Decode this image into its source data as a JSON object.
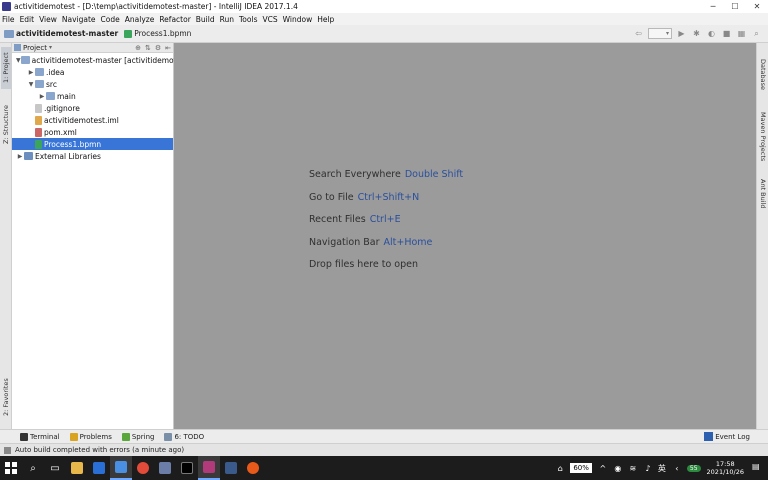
{
  "window": {
    "title": "activitidemotest - [D:\\temp\\activitidemotest-master] - IntelliJ IDEA 2017.1.4"
  },
  "menu": [
    "File",
    "Edit",
    "View",
    "Navigate",
    "Code",
    "Analyze",
    "Refactor",
    "Build",
    "Run",
    "Tools",
    "VCS",
    "Window",
    "Help"
  ],
  "navbar": {
    "project": "activitidemotest-master",
    "file": "Process1.bpmn"
  },
  "left_tabs": {
    "project": "1: Project",
    "structure": "Z: Structure",
    "favorites": "2: Favorites"
  },
  "right_tabs": {
    "database": "Database",
    "maven": "Maven Projects",
    "ant": "Ant Build"
  },
  "project_panel": {
    "header": "Project",
    "tree": [
      {
        "label": "activitidemotest-master [activitidemot",
        "arrow": "▼",
        "icon": "folder",
        "indent": 0
      },
      {
        "label": ".idea",
        "arrow": "▶",
        "icon": "folder",
        "indent": 1
      },
      {
        "label": "src",
        "arrow": "▼",
        "icon": "src",
        "indent": 1
      },
      {
        "label": "main",
        "arrow": "▶",
        "icon": "folder",
        "indent": 2
      },
      {
        "label": ".gitignore",
        "arrow": "",
        "icon": "file",
        "indent": 1
      },
      {
        "label": "activitidemotest.iml",
        "arrow": "",
        "icon": "xml",
        "indent": 1
      },
      {
        "label": "pom.xml",
        "arrow": "",
        "icon": "maven",
        "indent": 1
      },
      {
        "label": "Process1.bpmn",
        "arrow": "",
        "icon": "bpmn",
        "indent": 1,
        "selected": true
      },
      {
        "label": "External Libraries",
        "arrow": "▶",
        "icon": "lib",
        "indent": 0
      }
    ]
  },
  "editor_hints": [
    {
      "text": "Search Everywhere",
      "shortcut": "Double Shift"
    },
    {
      "text": "Go to File",
      "shortcut": "Ctrl+Shift+N"
    },
    {
      "text": "Recent Files",
      "shortcut": "Ctrl+E"
    },
    {
      "text": "Navigation Bar",
      "shortcut": "Alt+Home"
    },
    {
      "text": "Drop files here to open",
      "shortcut": ""
    }
  ],
  "tool_windows": [
    {
      "label": "Terminal",
      "color": "#333333"
    },
    {
      "label": "Problems",
      "color": "#d9a521"
    },
    {
      "label": "Spring",
      "color": "#5aa83c"
    },
    {
      "label": "6: TODO",
      "color": "#7a8fa8"
    }
  ],
  "event_log": "Event Log",
  "status": "Auto build completed with errors (a minute ago)",
  "taskbar": {
    "battery": "60%",
    "lang": "英",
    "badge": "55",
    "time": "17:58",
    "date": "2021/10/26"
  }
}
